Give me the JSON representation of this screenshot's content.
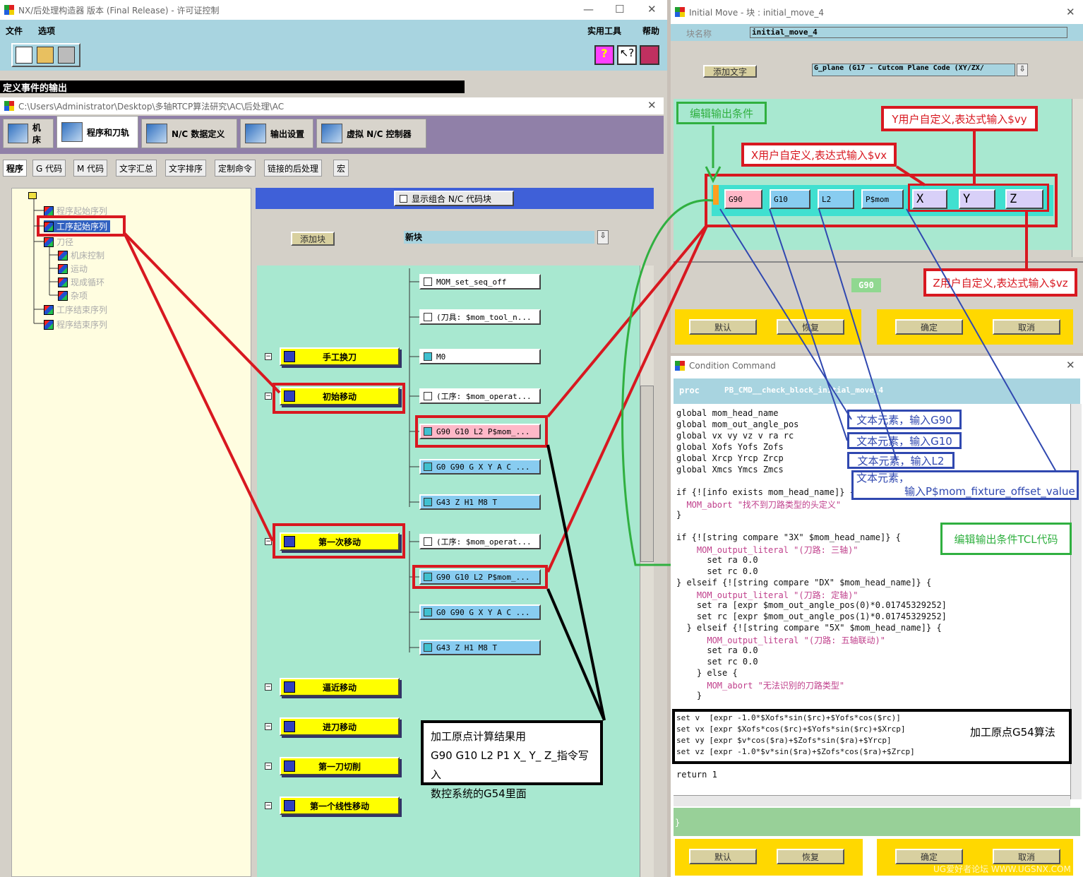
{
  "main_window": {
    "title": "NX/后处理构造器 版本 (Final Release) - 许可证控制",
    "menu": [
      "文件",
      "选项"
    ],
    "menu_right": [
      "实用工具",
      "帮助"
    ],
    "status_bar": "定义事件的输出",
    "path": "C:\\Users\\Administrator\\Desktop\\多轴RTCP算法研究\\AC\\后处理\\AC",
    "big_tabs": [
      "机床",
      "程序和刀轨",
      "N/C 数据定义",
      "输出设置",
      "虚拟 N/C 控制器"
    ],
    "sub_tabs": [
      "程序",
      "G 代码",
      "M 代码",
      "文字汇总",
      "文字排序",
      "定制命令",
      "链接的后处理",
      "宏"
    ],
    "tree": [
      "程序起始序列",
      "工序起始序列",
      "刀径",
      "机床控制",
      "运动",
      "现成循环",
      "杂项",
      "工序结束序列",
      "程序结束序列"
    ],
    "toggle_label": "显示组合 N/C 代码块",
    "add_block": "添加块",
    "new_block": "新块",
    "events": [
      "手工换刀",
      "初始移动",
      "第一次移动",
      "逼近移动",
      "进刀移动",
      "第一刀切削",
      "第一个线性移动"
    ],
    "nodes": {
      "n1": "MOM_set_seq_off",
      "n2": "(刀具: $mom_tool_n...",
      "n3": "M0",
      "n4": "(工序: $mom_operat...",
      "n5": "G90 G10 L2 P$mom_...",
      "n6": "G0 G90 G X Y A C ...",
      "n7": "G43 Z H1 M8 T",
      "n8": "(工序: $mom_operat...",
      "n9": "G90 G10 L2 P$mom_...",
      "n10": "G0 G90 G X Y A C ...",
      "n11": "G43 Z H1 M8 T"
    }
  },
  "initial_move": {
    "title": "Initial Move - 块 : initial_move_4",
    "block_label": "块名称",
    "block_name": "initial_move_4",
    "add_text": "添加文字",
    "word_select": "G_plane (G17 - Cutcom Plane Code (XY/ZX/",
    "elements": [
      "G90",
      "G10",
      "L2",
      "P$mom",
      "X",
      "Y",
      "Z"
    ],
    "preview": "G90",
    "buttons": [
      "默认",
      "恢复",
      "确定",
      "取消"
    ]
  },
  "condition": {
    "title": "Condition Command",
    "proc": "proc",
    "proc_name": "PB_CMD__check_block_initial_move_4",
    "code_lines": [
      "global mom_head_name",
      "global mom_out_angle_pos",
      "global vx vy vz v ra rc",
      "global Xofs Yofs Zofs",
      "global Xrcp Yrcp Zrcp",
      "global Xmcs Ymcs Zmcs",
      "",
      "if {![info exists mom_head_name]} {",
      "  MOM_abort \"找不到刀路类型的头定义\"",
      "}",
      "",
      "if {![string compare \"3X\" $mom_head_name]} {",
      "    MOM_output_literal \"(刀路: 三轴)\"",
      "      set ra 0.0",
      "      set rc 0.0",
      "} elseif {![string compare \"DX\" $mom_head_name]} {",
      "    MOM_output_literal \"(刀路: 定轴)\"",
      "    set ra [expr $mom_out_angle_pos(0)*0.01745329252]",
      "    set rc [expr $mom_out_angle_pos(1)*0.01745329252]",
      "  } elseif {![string compare \"5X\" $mom_head_name]} {",
      "      MOM_output_literal \"(刀路: 五轴联动)\"",
      "      set ra 0.0",
      "      set rc 0.0",
      "    } else {",
      "      MOM_abort \"无法识别的刀路类型\"",
      "    }"
    ],
    "calc_lines": [
      "set v  [expr -1.0*$Xofs*sin($rc)+$Yofs*cos($rc)]",
      "set vx [expr $Xofs*cos($rc)+$Yofs*sin($rc)+$Xrcp]",
      "set vy [expr $v*cos($ra)+$Zofs*sin($ra)+$Yrcp]",
      "set vz [expr -1.0*$v*sin($ra)+$Zofs*cos($ra)+$Zrcp]"
    ],
    "return_line": "return 1",
    "brace": "}",
    "buttons": [
      "默认",
      "恢复",
      "确定",
      "取消"
    ]
  },
  "annotations": {
    "edit_condition": "编辑输出条件",
    "y_user": "Y用户自定义,表达式输入$vy",
    "x_user": "X用户自定义,表达式输入$vx",
    "z_user": "Z用户自定义,表达式输入$vz",
    "text_g90": "文本元素，输入G90",
    "text_g10": "文本元素，输入G10",
    "text_l2": "文本元素，输入L2",
    "text_p1": "文本元素，",
    "text_p2": "输入P$mom_fixture_offset_value",
    "edit_tcl": "编辑输出条件TCL代码",
    "g54_algo": "加工原点G54算法",
    "note_line1": "加工原点计算结果用",
    "note_line2": "G90 G10 L2 P1 X_ Y_ Z_指令写入",
    "note_line3": "数控系统的G54里面"
  },
  "watermark": "UG爱好者论坛 WWW.UGSNX.COM",
  "colors": {
    "panel_bg": "#a8e8d0",
    "yellow": "#ffff00",
    "red": "#d81820",
    "blue": "#3048b0",
    "green": "#30b040",
    "tab_purple": "#9080a8"
  }
}
